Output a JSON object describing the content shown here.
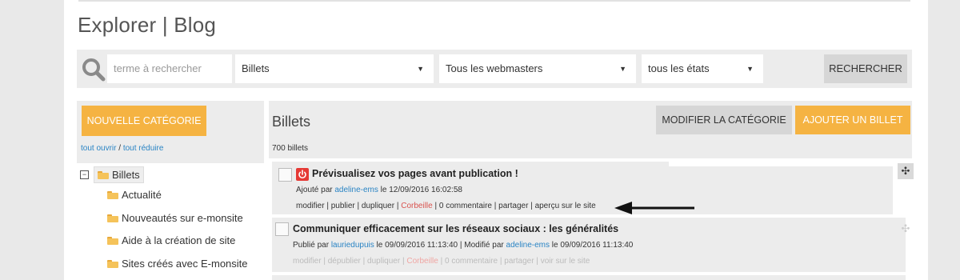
{
  "page": {
    "title": "Explorer | Blog"
  },
  "search": {
    "placeholder": "terme à rechercher",
    "type_select": "Billets",
    "webmaster_select": "Tous les webmasters",
    "status_select": "tous les états",
    "button": "RECHERCHER"
  },
  "sidebar": {
    "new_category_button": "NOUVELLE CATÉGORIE",
    "expand_all": "tout ouvrir",
    "separator": " / ",
    "collapse_all": "tout réduire",
    "root": {
      "toggle": "−",
      "label": "Billets"
    },
    "items": [
      {
        "label": "Actualité"
      },
      {
        "label": "Nouveautés sur e-monsite"
      },
      {
        "label": "Aide à la création de site"
      },
      {
        "label": "Sites créés avec E-monsite"
      }
    ]
  },
  "main": {
    "title": "Billets",
    "modify_category_button": "MODIFIER LA CATÉGORIE",
    "add_post_button": "AJOUTER UN BILLET",
    "count": "700 billets",
    "posts": [
      {
        "title": "Prévisualisez vos pages avant publication !",
        "meta_prefix": "Ajouté par ",
        "author": "adeline-ems",
        "meta_suffix": " le 12/09/2016 16:02:58",
        "actions": {
          "modify": "modifier",
          "publish": "publier",
          "duplicate": "dupliquer",
          "trash": "Corbeille",
          "comments": "0 commentaire",
          "share": "partager",
          "view": "aperçu sur le site",
          "sep": " | "
        }
      },
      {
        "title": "Communiquer efficacement sur les réseaux sociaux : les généralités",
        "meta_prefix": "Publié par ",
        "author": "lauriedupuis",
        "meta_mid": " le 09/09/2016 11:13:40 | Modifié par ",
        "modifier": "adeline-ems",
        "meta_suffix": " le 09/09/2016 11:13:40",
        "actions": {
          "modify": "modifier",
          "publish": "dépublier",
          "duplicate": "dupliquer",
          "trash": "Corbeille",
          "comments": "0 commentaire",
          "share": "partager",
          "view": "voir sur le site",
          "sep": " | "
        }
      }
    ]
  },
  "icons": {
    "search": "search-icon",
    "power": "power-icon",
    "folder": "folder-icon",
    "move": "move-icon",
    "move_glyph": "✣",
    "dropdown_glyph": "▼"
  },
  "colors": {
    "accent_orange": "#f5b342",
    "link_blue": "#2a84c4",
    "danger_red": "#e53935",
    "panel_gray": "#ececec"
  }
}
